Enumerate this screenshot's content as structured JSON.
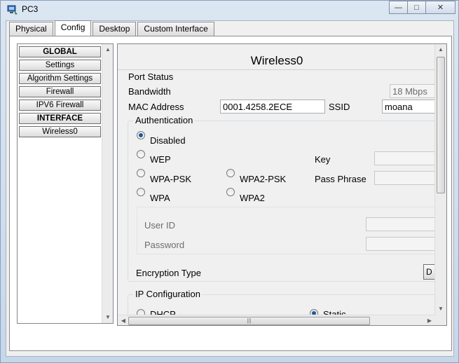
{
  "window": {
    "title": "PC3",
    "controls": {
      "minimize": "—",
      "maximize": "□",
      "close": "✕"
    }
  },
  "tabs": [
    {
      "label": "Physical"
    },
    {
      "label": "Config"
    },
    {
      "label": "Desktop"
    },
    {
      "label": "Custom Interface"
    }
  ],
  "active_tab": "Config",
  "sidebar": {
    "items": [
      {
        "label": "GLOBAL",
        "kind": "header"
      },
      {
        "label": "Settings"
      },
      {
        "label": "Algorithm Settings"
      },
      {
        "label": "Firewall"
      },
      {
        "label": "IPV6 Firewall"
      },
      {
        "label": "INTERFACE",
        "kind": "header"
      },
      {
        "label": "Wireless0"
      }
    ]
  },
  "panel": {
    "title": "Wireless0",
    "port_status_label": "Port Status",
    "bandwidth_label": "Bandwidth",
    "bandwidth_value": "18 Mbps",
    "mac_label": "MAC Address",
    "mac_value": "0001.4258.2ECE",
    "ssid_label": "SSID",
    "ssid_value": "moana",
    "auth": {
      "title": "Authentication",
      "disabled": "Disabled",
      "wep": "WEP",
      "wpa_psk": "WPA-PSK",
      "wpa2_psk": "WPA2-PSK",
      "wpa": "WPA",
      "wpa2": "WPA2",
      "key_label": "Key",
      "pass_phrase_label": "Pass Phrase",
      "user_id_label": "User ID",
      "password_label": "Password",
      "selected": "Disabled"
    },
    "encryption_label": "Encryption Type",
    "encryption_button": "D",
    "ip_config": {
      "title": "IP Configuration",
      "dhcp": "DHCP",
      "static": "Static"
    }
  }
}
